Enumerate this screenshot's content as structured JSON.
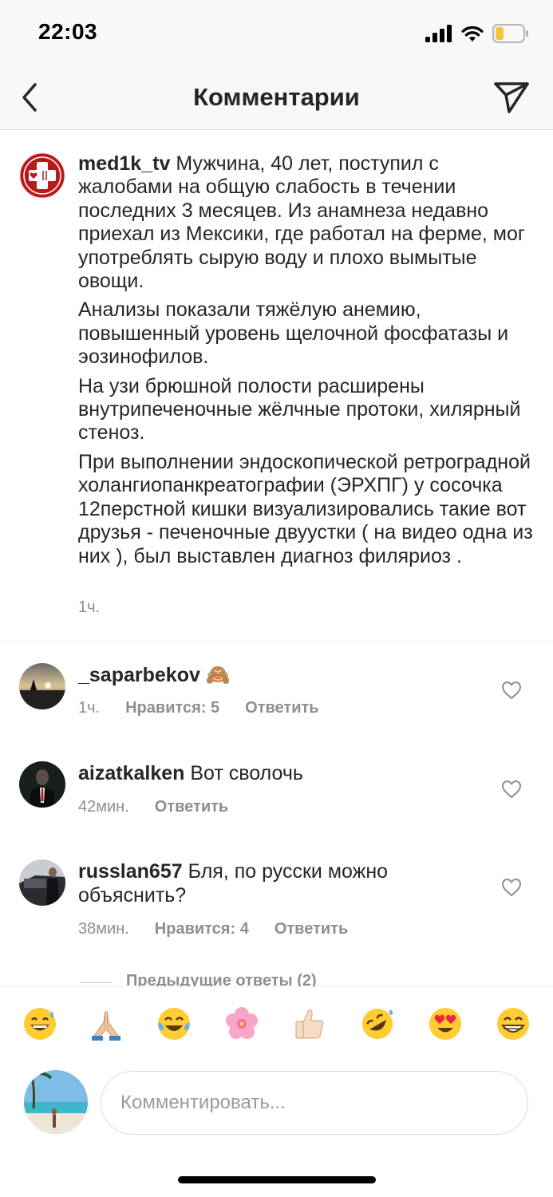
{
  "status_bar": {
    "time": "22:03"
  },
  "header": {
    "title": "Комментарии"
  },
  "caption": {
    "username": "med1k_tv",
    "paragraphs": [
      "Мужчина, 40 лет, поступил с жалобами на общую слабость в течении последних 3 месяцев. Из анамнеза недавно приехал из Мексики, где работал на ферме, мог употреблять сырую воду и плохо вымытые овощи.",
      "Анализы показали тяжёлую анемию, повышенный уровень щелочной фосфатазы и эозинофилов.",
      "На узи брюшной полости расширены внутрипеченочные жёлчные протоки, хилярный стеноз.",
      "При выполнении эндоскопической ретроградной холангиопанкреатографии (ЭРХПГ) у сосочка 12перстной кишки визуализировались такие вот друзья - печеночные двуустки ( на видео одна из них ), был выставлен диагноз филяриоз ."
    ],
    "time": "1ч."
  },
  "comments": [
    {
      "username": "_saparbekov",
      "text": "🙈",
      "time": "1ч.",
      "likes": "Нравится: 5",
      "reply": "Ответить"
    },
    {
      "username": "aizatkalken",
      "text": "Вот сволочь",
      "time": "42мин.",
      "reply": "Ответить"
    },
    {
      "username": "russlan657",
      "text": "Бля, по русски можно объяснить?",
      "time": "38мин.",
      "likes": "Нравится: 4",
      "reply": "Ответить"
    }
  ],
  "previous_replies": "Предыдущие ответы (2)",
  "emoji_bar": [
    "grinning-sweat",
    "folded-hands",
    "tears-of-joy",
    "cherry-blossom",
    "thumbs-up",
    "rolling-laughing",
    "heart-eyes",
    "beaming-grin"
  ],
  "composer": {
    "placeholder": "Комментировать..."
  },
  "colors": {
    "text": "#262626",
    "secondary": "#8e8e8e",
    "border": "#dbdbdb",
    "bar_bg": "#f8f8f8"
  }
}
